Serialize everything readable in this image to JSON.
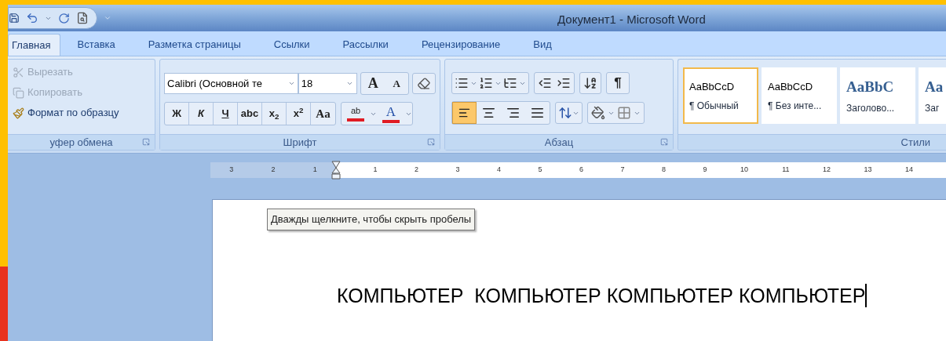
{
  "window": {
    "title": "Документ1 - Microsoft Word"
  },
  "tabs": [
    {
      "label": "Главная",
      "selected": true
    },
    {
      "label": "Вставка",
      "selected": false
    },
    {
      "label": "Разметка страницы",
      "selected": false
    },
    {
      "label": "Ссылки",
      "selected": false
    },
    {
      "label": "Рассылки",
      "selected": false
    },
    {
      "label": "Рецензирование",
      "selected": false
    },
    {
      "label": "Вид",
      "selected": false
    }
  ],
  "clipboard": {
    "label": "уфер обмена",
    "items": [
      {
        "kind": "cut",
        "label": "Вырезать",
        "disabled": true
      },
      {
        "kind": "copy",
        "label": "Копировать",
        "disabled": true
      },
      {
        "kind": "format",
        "label": "Формат по образцу",
        "disabled": false
      }
    ]
  },
  "font": {
    "label": "Шрифт",
    "font_name": "Calibri (Основной те",
    "font_size": "18",
    "grow": "A",
    "shrink": "A",
    "format_buttons": [
      {
        "kind": "bold",
        "label": "Ж"
      },
      {
        "kind": "italic",
        "label": "К"
      },
      {
        "kind": "underline",
        "label": "Ч"
      },
      {
        "kind": "strike",
        "label": "abc"
      },
      {
        "kind": "plain",
        "label": "x$_{2}$"
      },
      {
        "kind": "plain",
        "label": "x$^{2}$"
      },
      {
        "kind": "serif",
        "label": "Aa"
      }
    ],
    "highlight": "ab",
    "color_letter": "A"
  },
  "paragraph": {
    "label": "Абзац",
    "pilcrow": "¶",
    "alignment": [
      {
        "kind": "left",
        "selected": true
      },
      {
        "kind": "center",
        "selected": false
      },
      {
        "kind": "right",
        "selected": false
      },
      {
        "kind": "justify",
        "selected": false
      }
    ]
  },
  "styles": {
    "label": "Стили",
    "items": [
      {
        "kind": "normal",
        "sample": "AaBbCcD",
        "name": "¶ Обычный",
        "selected": true
      },
      {
        "kind": "normal",
        "sample": "AaBbCcD",
        "name": "¶ Без инте...",
        "selected": false
      },
      {
        "kind": "heading",
        "sample": "AaBbC",
        "name": "Заголово...",
        "selected": false
      },
      {
        "kind": "heading",
        "sample": "Aa",
        "name": "Заг",
        "selected": false
      }
    ]
  },
  "ruler": {
    "left_numbers": [
      "3",
      "2",
      "1"
    ],
    "right_numbers": [
      "1",
      "2",
      "3",
      "4",
      "5",
      "6",
      "7",
      "8",
      "9",
      "10",
      "11",
      "12",
      "13",
      "14"
    ]
  },
  "tooltip": "Дважды щелкните, чтобы скрыть пробелы",
  "document": {
    "text": "КОМПЬЮТЕР  КОМПЬЮТЕР КОМПЬЮТЕР КОМПЬЮТЕР"
  }
}
